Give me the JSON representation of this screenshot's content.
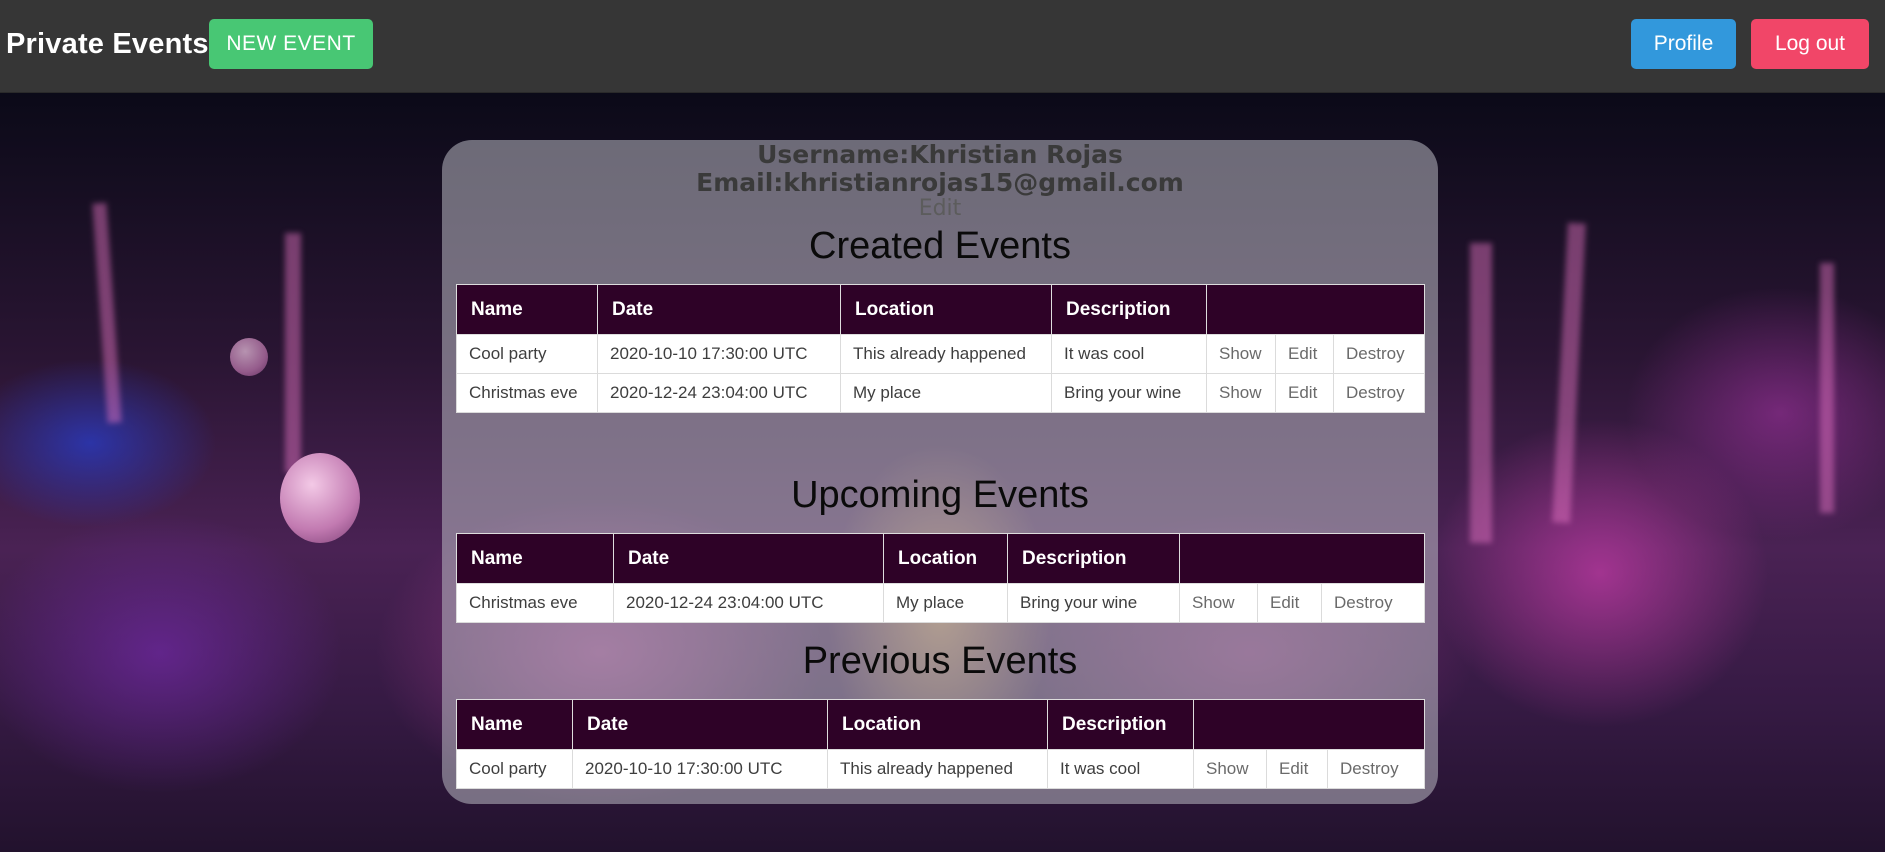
{
  "nav": {
    "brand": "Private Events",
    "new_event": "NEW EVENT",
    "profile": "Profile",
    "logout": "Log out"
  },
  "user": {
    "username_line": "Username:Khristian Rojas",
    "email_line": "Email:khristianrojas15@gmail.com",
    "edit_link": "Edit"
  },
  "columns": [
    "Name",
    "Date",
    "Location",
    "Description"
  ],
  "actions": [
    "Show",
    "Edit",
    "Destroy"
  ],
  "sections": {
    "created": {
      "title": "Created Events",
      "rows": [
        {
          "name": "Cool party",
          "date": "2020-10-10 17:30:00 UTC",
          "location": "This already happened",
          "description": "It was cool"
        },
        {
          "name": "Christmas eve",
          "date": "2020-12-24 23:04:00 UTC",
          "location": "My place",
          "description": "Bring your wine"
        }
      ]
    },
    "upcoming": {
      "title": "Upcoming Events",
      "rows": [
        {
          "name": "Christmas eve",
          "date": "2020-12-24 23:04:00 UTC",
          "location": "My place",
          "description": "Bring your wine"
        }
      ]
    },
    "previous": {
      "title": "Previous Events",
      "rows": [
        {
          "name": "Cool party",
          "date": "2020-10-10 17:30:00 UTC",
          "location": "This already happened",
          "description": "It was cool"
        }
      ]
    }
  },
  "colors": {
    "navbar": "#363636",
    "new_event_button": "#48c774",
    "profile_button": "#3298dc",
    "logout_button": "#f14668",
    "table_header": "#2e0227"
  }
}
